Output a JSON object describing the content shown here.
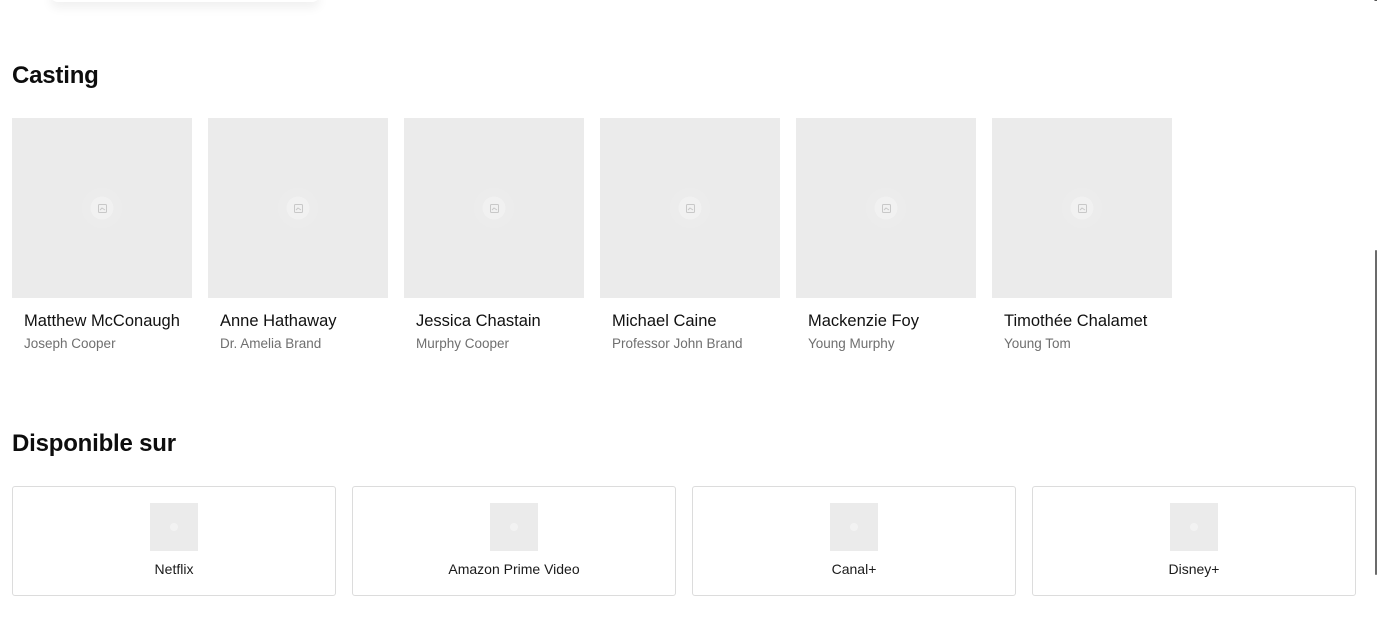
{
  "casting": {
    "title": "Casting",
    "members": [
      {
        "name": "Matthew McConaughey",
        "role": "Joseph Cooper"
      },
      {
        "name": "Anne Hathaway",
        "role": "Dr. Amelia Brand"
      },
      {
        "name": "Jessica Chastain",
        "role": "Murphy Cooper"
      },
      {
        "name": "Michael Caine",
        "role": "Professor John Brand"
      },
      {
        "name": "Mackenzie Foy",
        "role": "Young Murphy"
      },
      {
        "name": "Timothée Chalamet",
        "role": "Young Tom"
      }
    ]
  },
  "availability": {
    "title": "Disponible sur",
    "providers": [
      {
        "name": "Netflix"
      },
      {
        "name": "Amazon Prime Video"
      },
      {
        "name": "Canal+"
      },
      {
        "name": "Disney+"
      }
    ]
  },
  "icons": {
    "photo_placeholder": "image-placeholder-icon",
    "provider_logo": "provider-logo-icon"
  },
  "colors": {
    "placeholder_bg": "#ebebeb",
    "border": "#dcdcdc",
    "muted_text": "#6f6f6f"
  }
}
